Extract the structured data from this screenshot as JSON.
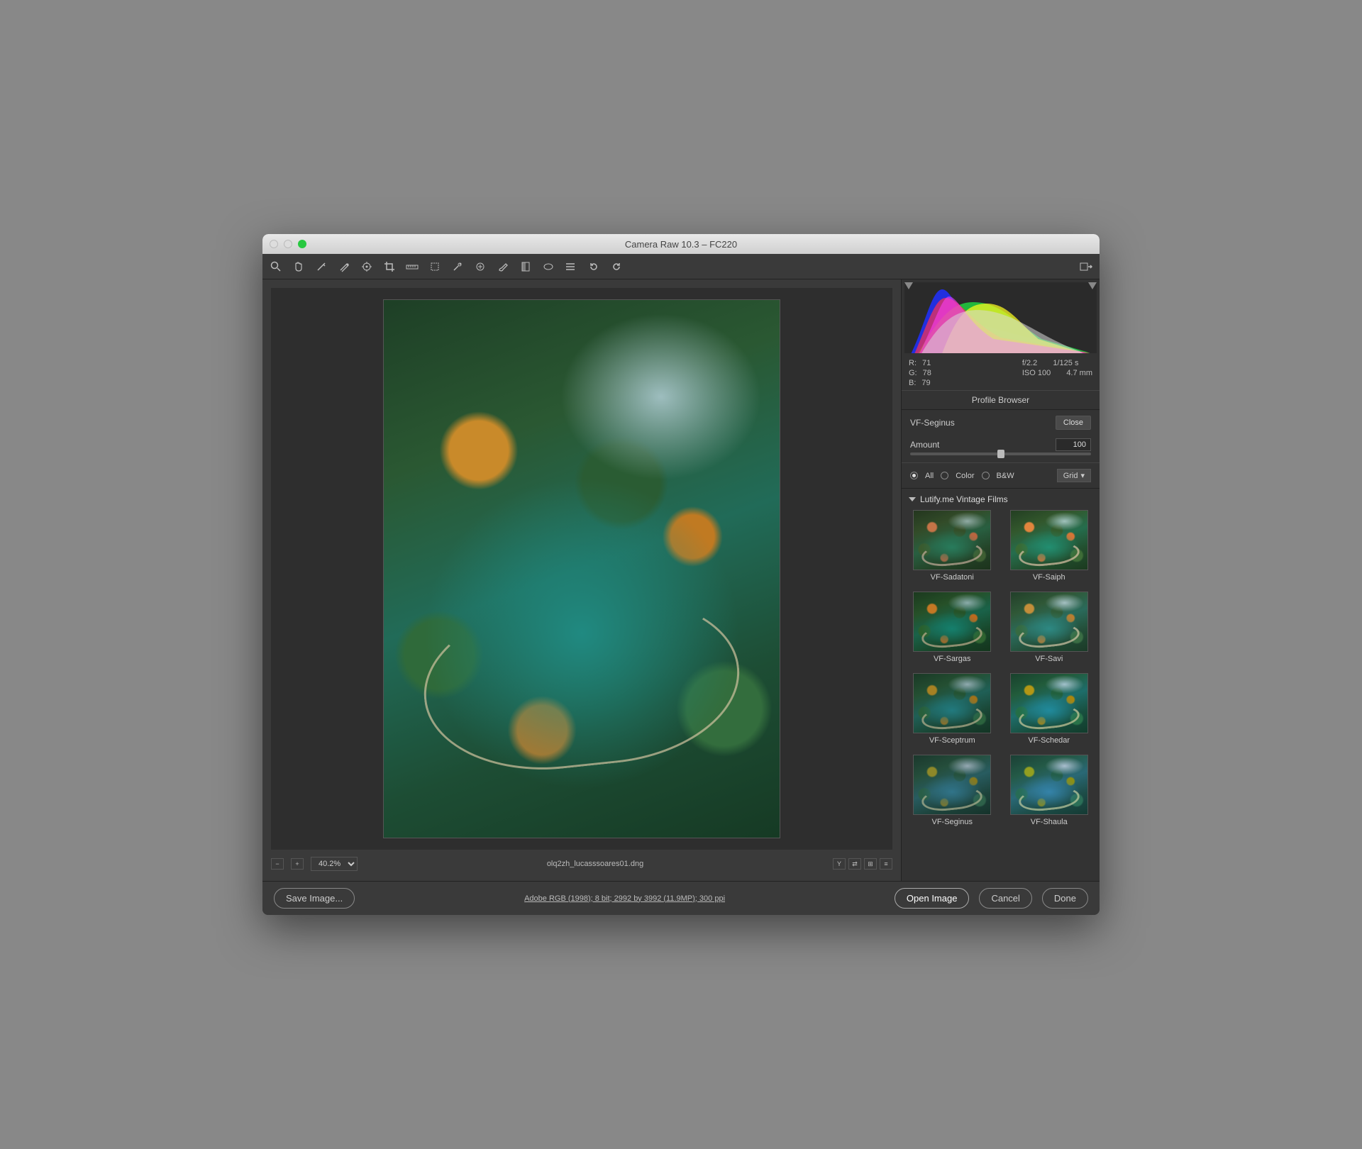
{
  "window": {
    "title": "Camera Raw 10.3  –  FC220"
  },
  "toolbar": {
    "tools": [
      "zoom",
      "hand",
      "white-balance",
      "color-sampler",
      "target-adjust",
      "crop",
      "straighten",
      "transform",
      "spot-removal",
      "red-eye",
      "adjustment-brush",
      "graduated-filter",
      "radial-filter",
      "presets",
      "rotate-ccw",
      "rotate-cw"
    ],
    "export_label": "Export"
  },
  "preview": {
    "zoom": "40.2%",
    "filename": "olq2zh_lucasssoares01.dng",
    "view_icons": [
      "Y",
      "compare",
      "swap",
      "sliders"
    ]
  },
  "readout": {
    "R": "71",
    "G": "78",
    "B": "79",
    "aperture": "f/2.2",
    "shutter": "1/125 s",
    "iso": "ISO 100",
    "focal": "4.7 mm"
  },
  "panel": {
    "title": "Profile Browser",
    "profile_name": "VF-Seginus",
    "close_label": "Close",
    "amount_label": "Amount",
    "amount_value": "100",
    "amount_percent": 50,
    "filters": {
      "all": "All",
      "color": "Color",
      "bw": "B&W",
      "selected": "all"
    },
    "view": "Grid",
    "group": "Lutify.me Vintage Films",
    "thumbs": [
      "VF-Sadatoni",
      "VF-Saiph",
      "VF-Sargas",
      "VF-Savi",
      "VF-Sceptrum",
      "VF-Schedar",
      "VF-Seginus",
      "VF-Shaula"
    ]
  },
  "footer": {
    "save": "Save Image...",
    "meta": "Adobe RGB (1998); 8 bit; 2992 by 3992 (11.9MP); 300 ppi",
    "open": "Open Image",
    "cancel": "Cancel",
    "done": "Done"
  }
}
